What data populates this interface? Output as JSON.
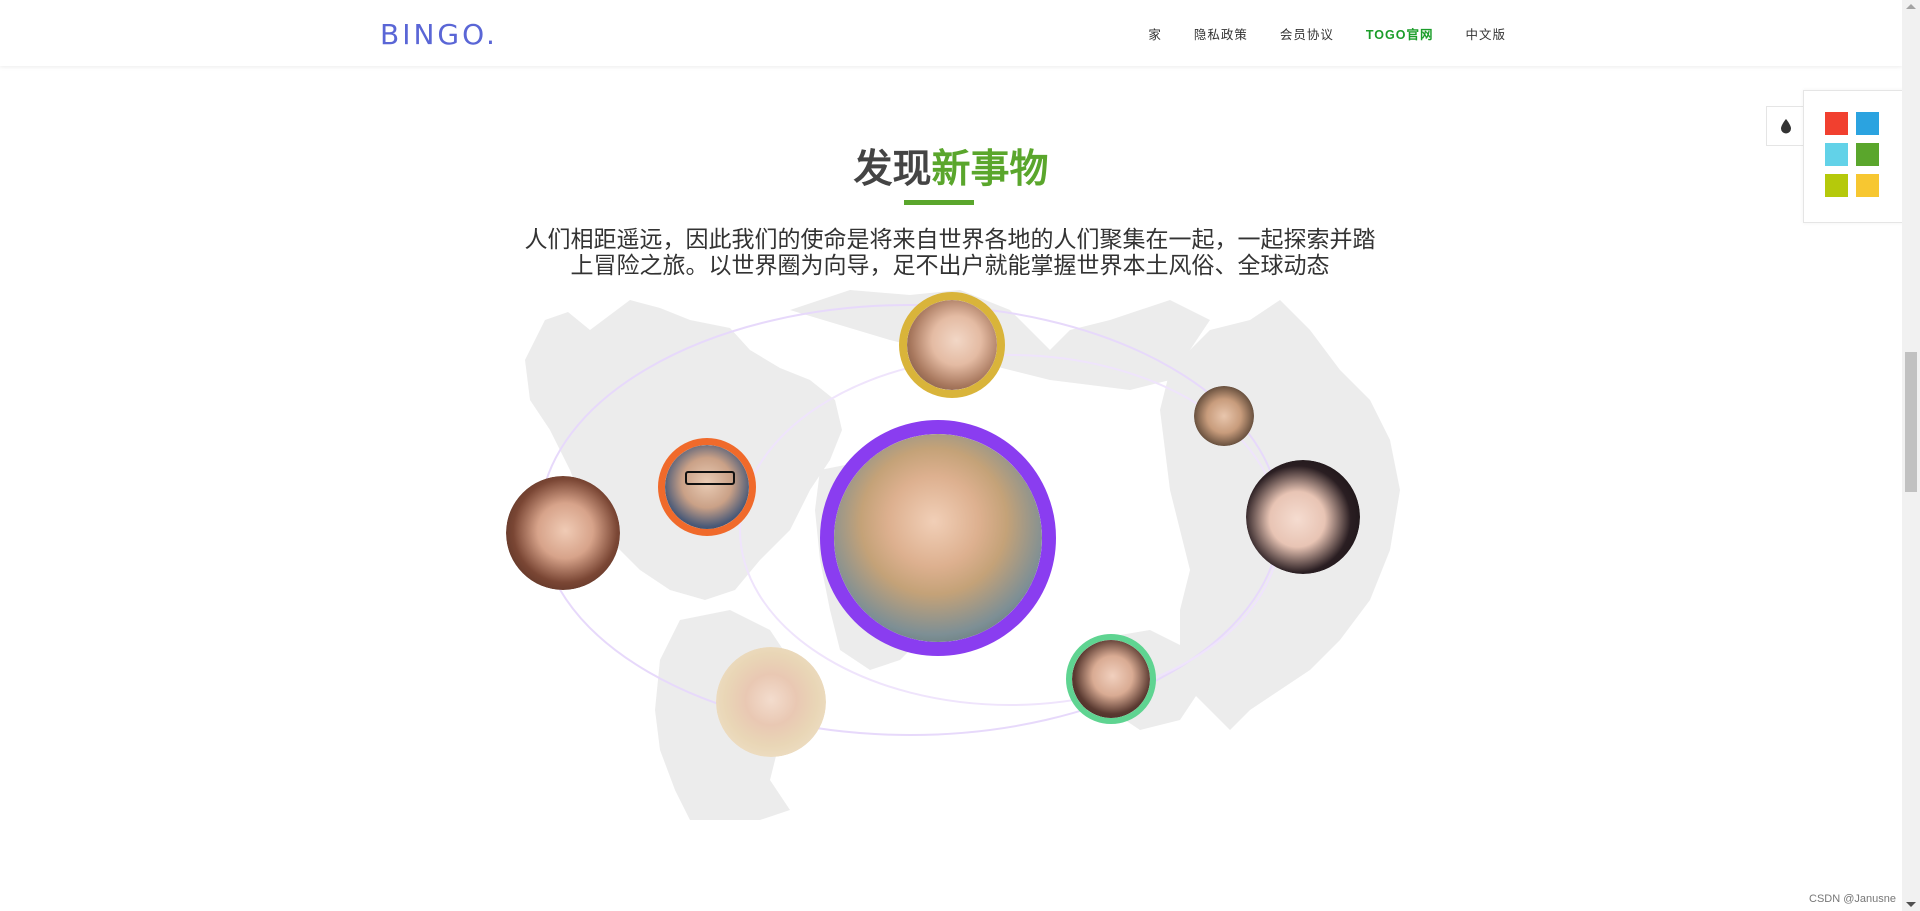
{
  "header": {
    "logo": "BINGO.",
    "nav": [
      {
        "label": "家"
      },
      {
        "label": "隐私政策"
      },
      {
        "label": "会员协议"
      },
      {
        "label": "TOGO官网",
        "active": true
      },
      {
        "label": "中文版"
      }
    ]
  },
  "main": {
    "heading_dark": "发现",
    "heading_accent": "新事物",
    "subtitle_line1": "人们相距遥远，因此我们的使命是将来自世界各地的人们聚集在一起，一起探索并踏",
    "subtitle_line2": "上冒险之旅。以世界圈为向导，足不出户就能掌握世界本土风俗、全球动态"
  },
  "colors": {
    "accent_green": "#5aa62c",
    "logo_blue": "#5a66d6",
    "nav_active": "#1b9d2a"
  },
  "avatars": [
    {
      "name": "avatar-woman-top",
      "border": "#d9b43a"
    },
    {
      "name": "avatar-man-glasses",
      "border": "#f06a2b"
    },
    {
      "name": "avatar-woman-left",
      "border": "none"
    },
    {
      "name": "avatar-woman-center",
      "border": "#8a3df0"
    },
    {
      "name": "avatar-man-right",
      "border": "none"
    },
    {
      "name": "avatar-woman-right",
      "border": "none"
    },
    {
      "name": "avatar-woman-blonde",
      "border": "none"
    },
    {
      "name": "avatar-woman-bottom-right",
      "border": "#5fd491"
    }
  ],
  "theme_panel": {
    "toggle_icon": "drop-icon",
    "swatches": [
      "#f1402f",
      "#2ba3e0",
      "#62d2e8",
      "#5aa62c",
      "#b5c90b",
      "#f7c731"
    ]
  },
  "watermark": "CSDN @Janusne"
}
